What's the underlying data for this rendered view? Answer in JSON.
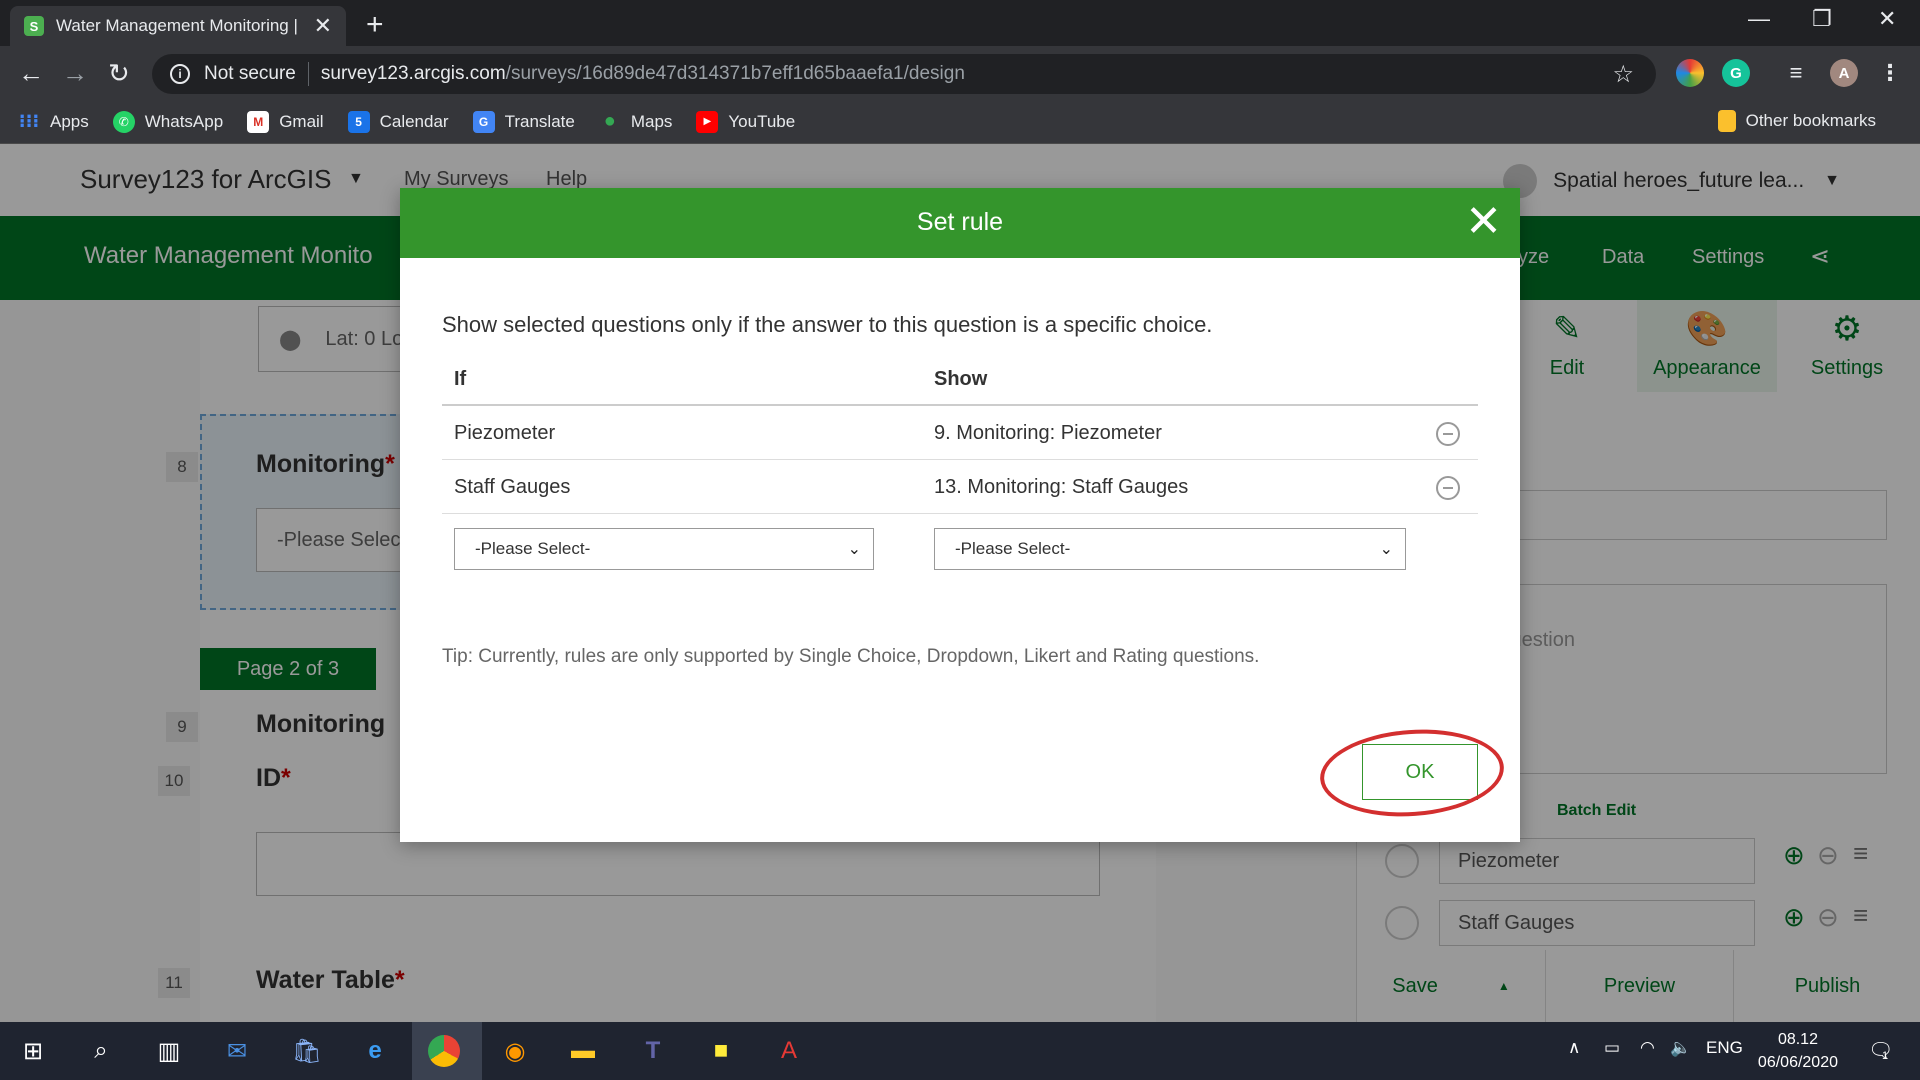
{
  "browser": {
    "tab_title": "Water Management Monitoring |",
    "tab_favicon": "survey123-icon",
    "security_label": "Not secure",
    "url_host": "survey123.arcgis.com",
    "url_path": "/surveys/16d89de47d314371b7eff1d65baaefa1/design",
    "profile_initial": "A",
    "bookmarks": [
      {
        "label": "Apps",
        "icon": "apps-grid-icon",
        "color": "#4285f4"
      },
      {
        "label": "WhatsApp",
        "icon": "whatsapp-icon",
        "color": "#25d366"
      },
      {
        "label": "Gmail",
        "icon": "gmail-icon",
        "color": "#d93025"
      },
      {
        "label": "Calendar",
        "icon": "calendar-icon",
        "color": "#1a73e8"
      },
      {
        "label": "Translate",
        "icon": "translate-icon",
        "color": "#4285f4"
      },
      {
        "label": "Maps",
        "icon": "maps-icon",
        "color": "#34a853"
      },
      {
        "label": "YouTube",
        "icon": "youtube-icon",
        "color": "#ff0000"
      }
    ],
    "other_bookmarks": "Other bookmarks"
  },
  "app": {
    "name": "Survey123 for ArcGIS",
    "nav": [
      "My Surveys",
      "Help"
    ],
    "user": "Spatial heroes_future lea...",
    "survey_title": "Water Management Monito",
    "survey_nav": [
      "yze",
      "Data",
      "Settings"
    ]
  },
  "form": {
    "location_placeholder": "Lat: 0 Lo",
    "q8_number": "8",
    "q8_title": "Monitoring",
    "q8_placeholder": "-Please Selec",
    "page_label": "Page 2 of 3",
    "q9_number": "9",
    "q9_title": "Monitoring",
    "q10_number": "10",
    "q10_title": "ID",
    "q11_number": "11",
    "q11_title": "Water Table",
    "required_mark": "*"
  },
  "panel": {
    "tabs": [
      {
        "label": "Edit",
        "icon": "pencil-icon"
      },
      {
        "label": "Appearance",
        "icon": "palette-icon"
      },
      {
        "label": "Settings",
        "icon": "gear-icon"
      }
    ],
    "hint_text": "to fill this question",
    "batch_edit": "Batch Edit",
    "choices": [
      "Piezometer",
      "Staff Gauges"
    ],
    "footer": [
      "Save",
      "Preview",
      "Publish"
    ]
  },
  "modal": {
    "title": "Set rule",
    "description": "Show selected questions only if the answer to this question is a specific choice.",
    "col_if": "If",
    "col_show": "Show",
    "rules": [
      {
        "if": "Piezometer",
        "show": "9. Monitoring: Piezometer"
      },
      {
        "if": "Staff Gauges",
        "show": "13. Monitoring: Staff Gauges"
      }
    ],
    "select_if_placeholder": "-Please Select-",
    "select_show_placeholder": "-Please Select-",
    "tip": "Tip: Currently, rules are only supported by Single Choice, Dropdown, Likert and Rating questions.",
    "ok_label": "OK",
    "accent_color": "#34952c"
  },
  "taskbar": {
    "language": "ENG",
    "time": "08.12",
    "date": "06/06/2020",
    "notifications": "1"
  }
}
